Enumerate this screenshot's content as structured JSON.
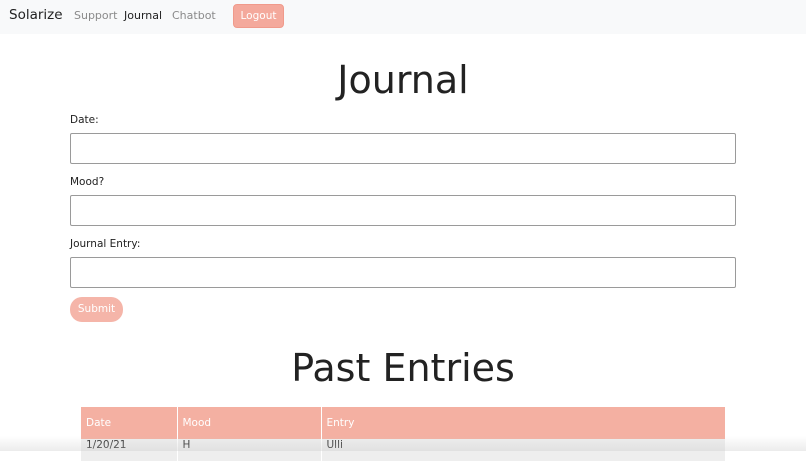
{
  "navbar": {
    "brand": "Solarize",
    "links": [
      {
        "label": "Support"
      },
      {
        "label": "Journal"
      },
      {
        "label": "Chatbot"
      }
    ],
    "logout_label": "Logout"
  },
  "form": {
    "title": "Journal",
    "fields": [
      {
        "label": "Date:",
        "value": "",
        "placeholder": ""
      },
      {
        "label": "Mood?",
        "value": "",
        "placeholder": ""
      },
      {
        "label": "Journal Entry:",
        "value": "",
        "placeholder": ""
      }
    ],
    "submit_label": "Submit"
  },
  "entries": {
    "title": "Past Entries",
    "columns": [
      "Date",
      "Mood",
      "Entry"
    ],
    "rows": [
      [
        "1/20/21",
        "H",
        "Ulli"
      ]
    ]
  },
  "colors": {
    "accent": "#f4a99c",
    "navbar_bg": "#f8f9fa",
    "table_header": "#f4b0a2"
  }
}
